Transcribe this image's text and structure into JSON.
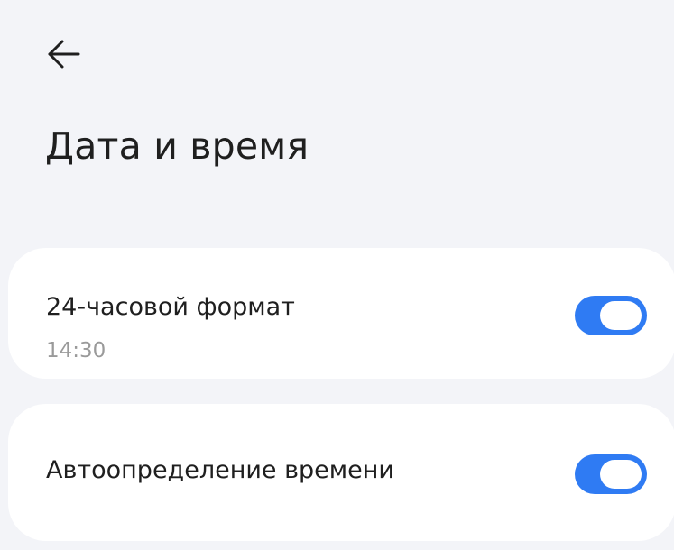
{
  "header": {
    "back_icon": "arrow-left-icon",
    "title": "Дата и время"
  },
  "settings": [
    {
      "title": "24-часовой формат",
      "subtitle": "14:30",
      "toggle_on": true
    },
    {
      "title": "Автоопределение времени",
      "toggle_on": true
    }
  ],
  "colors": {
    "background": "#f3f4f8",
    "card": "#ffffff",
    "accent": "#2f7bf3",
    "secondary_text": "#9a9a9a"
  }
}
